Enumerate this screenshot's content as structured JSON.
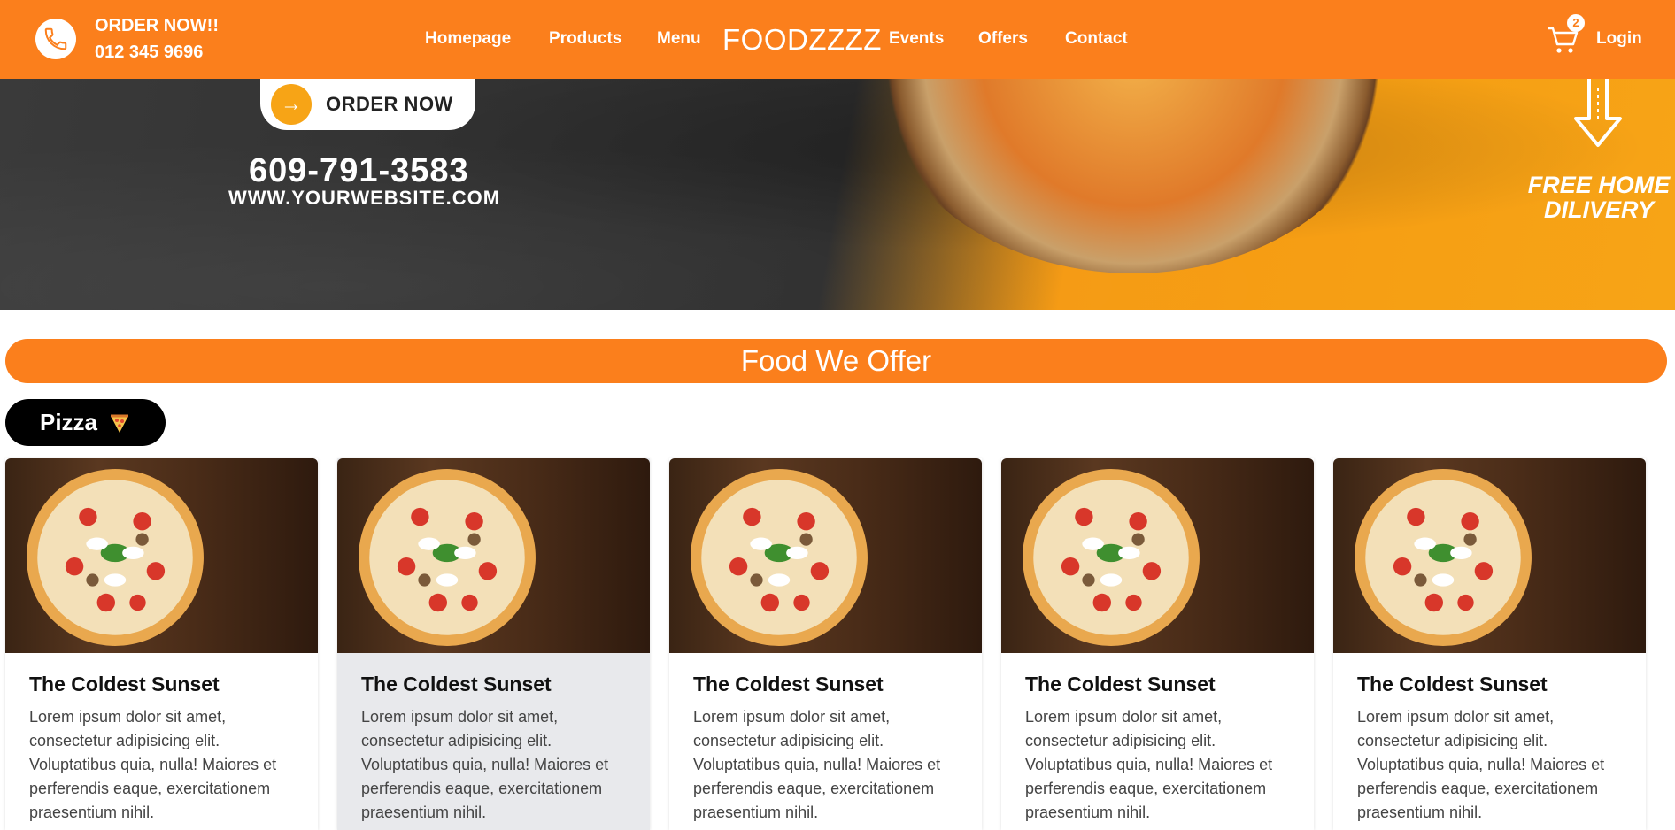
{
  "header": {
    "order_label": "ORDER NOW!!",
    "order_phone": "012 345 9696",
    "nav": [
      "Homepage",
      "Products",
      "Menu",
      "Events",
      "Offers",
      "Contact"
    ],
    "brand": "FOODZZZZ",
    "cart_count": "2",
    "login": "Login"
  },
  "hero": {
    "order_button": "ORDER NOW",
    "phone": "609-791-3583",
    "website": "WWW.YOURWEBSITE.COM",
    "free_delivery_line1": "FREE HOME",
    "free_delivery_line2": "DILIVERY"
  },
  "section": {
    "title": "Food We Offer",
    "category": "Pizza"
  },
  "cards": [
    {
      "title": "The Coldest Sunset",
      "text": "Lorem ipsum dolor sit amet, consectetur adipisicing elit. Voluptatibus quia, nulla! Maiores et perferendis eaque, exercitationem praesentium nihil."
    },
    {
      "title": "The Coldest Sunset",
      "text": "Lorem ipsum dolor sit amet, consectetur adipisicing elit. Voluptatibus quia, nulla! Maiores et perferendis eaque, exercitationem praesentium nihil."
    },
    {
      "title": "The Coldest Sunset",
      "text": "Lorem ipsum dolor sit amet, consectetur adipisicing elit. Voluptatibus quia, nulla! Maiores et perferendis eaque, exercitationem praesentium nihil."
    },
    {
      "title": "The Coldest Sunset",
      "text": "Lorem ipsum dolor sit amet, consectetur adipisicing elit. Voluptatibus quia, nulla! Maiores et perferendis eaque, exercitationem praesentium nihil."
    },
    {
      "title": "The Coldest Sunset",
      "text": "Lorem ipsum dolor sit amet, consectetur adipisicing elit. Voluptatibus quia, nulla! Maiores et perferendis eaque, exercitationem praesentium nihil."
    }
  ],
  "colors": {
    "accent": "#fb7f1c",
    "category_bg": "#000000",
    "card_hover_bg": "#e8e9ec"
  }
}
